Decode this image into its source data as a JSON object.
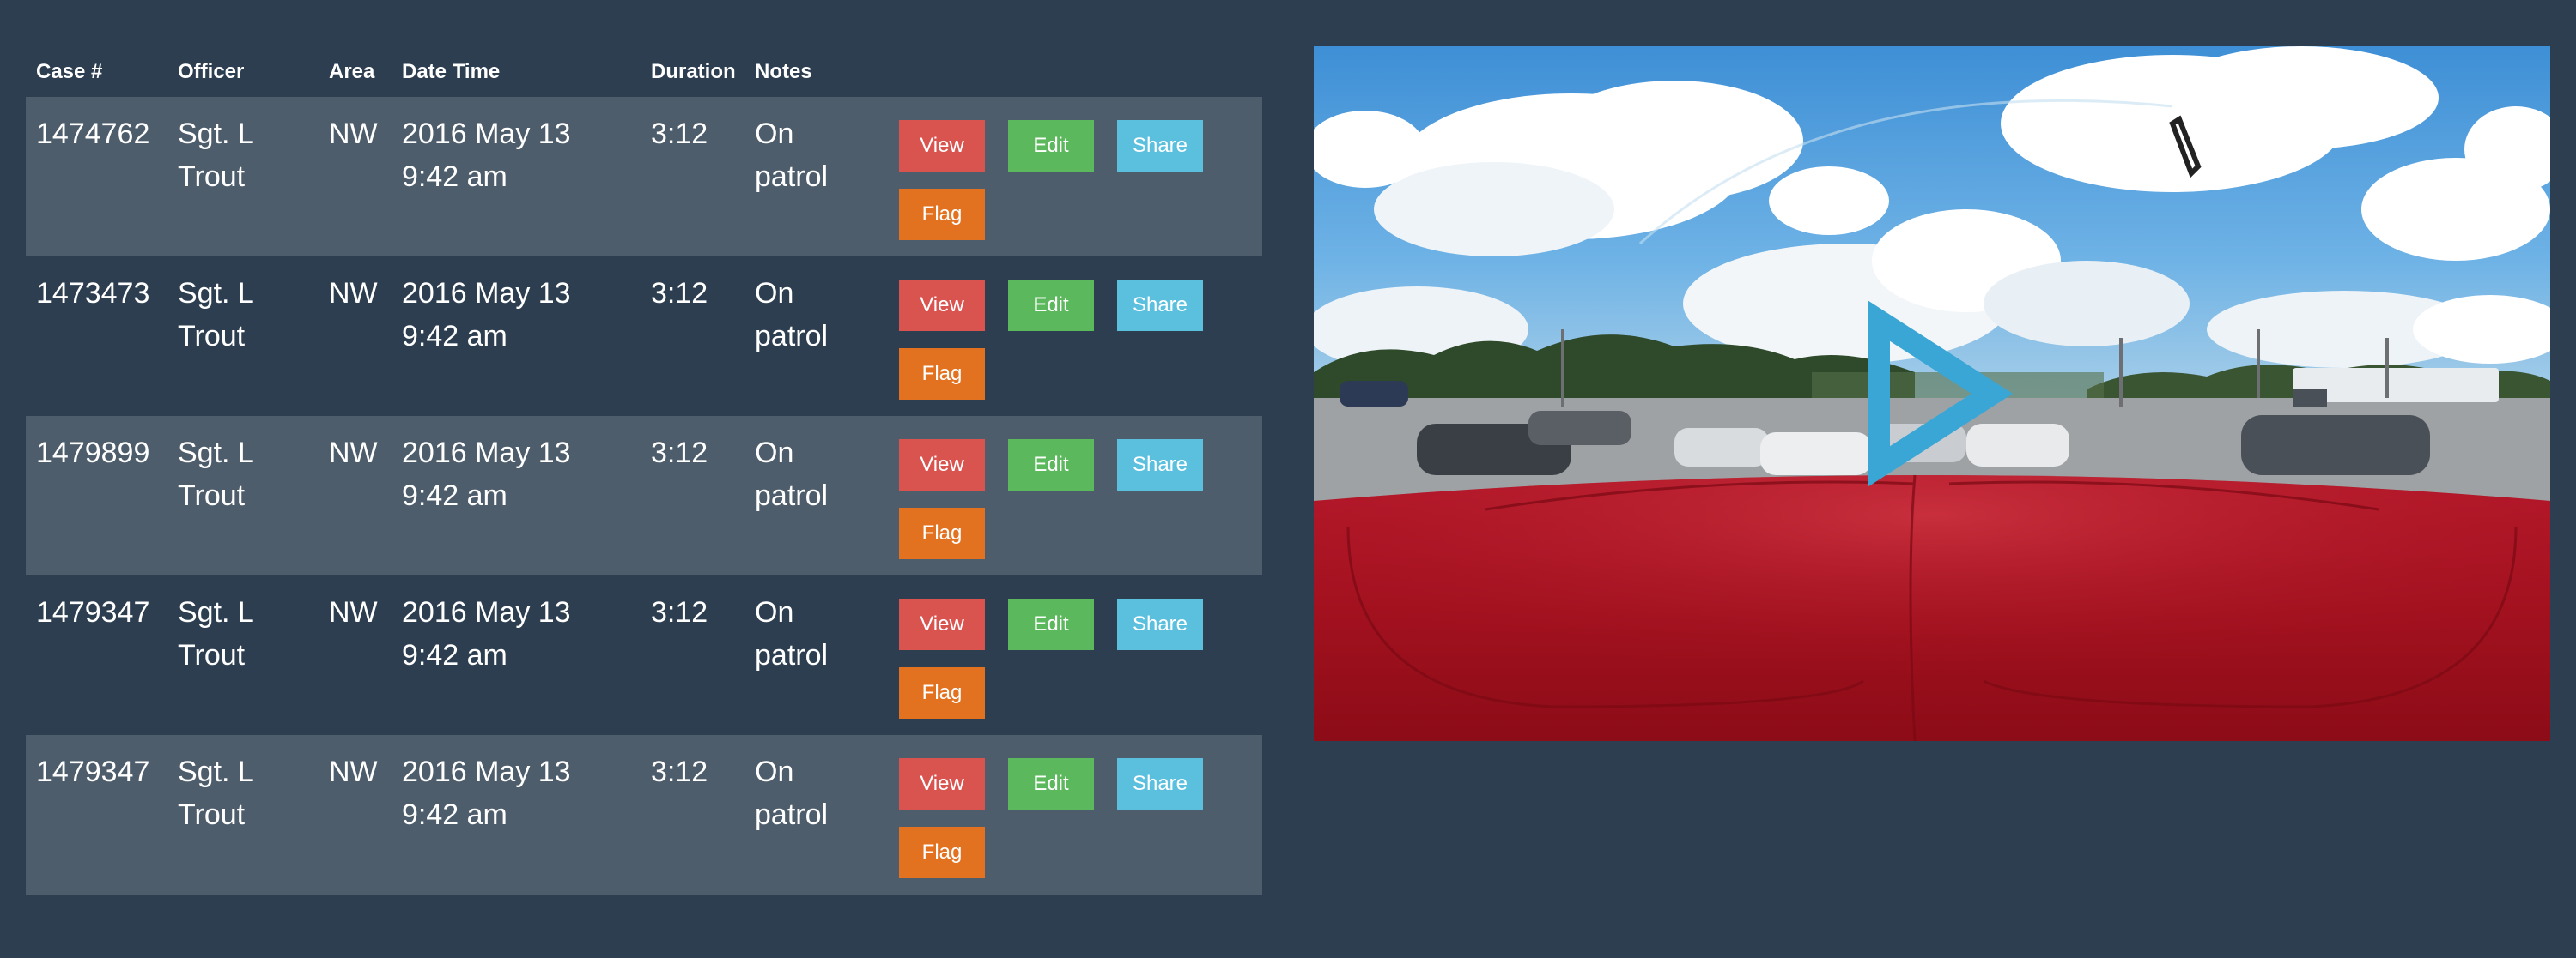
{
  "table": {
    "headers": {
      "case": "Case #",
      "officer": "Officer",
      "area": "Area",
      "datetime": "Date Time",
      "duration": "Duration",
      "notes": "Notes"
    },
    "rows": [
      {
        "case": "1474762",
        "officer_line1": "Sgt. L",
        "officer_line2": "Trout",
        "area": "NW",
        "date": "2016 May 13",
        "time": "9:42 am",
        "duration": "3:12",
        "notes_line1": "On",
        "notes_line2": "patrol"
      },
      {
        "case": "1473473",
        "officer_line1": "Sgt. L",
        "officer_line2": "Trout",
        "area": "NW",
        "date": "2016 May 13",
        "time": "9:42 am",
        "duration": "3:12",
        "notes_line1": "On",
        "notes_line2": "patrol"
      },
      {
        "case": "1479899",
        "officer_line1": "Sgt. L",
        "officer_line2": "Trout",
        "area": "NW",
        "date": "2016 May 13",
        "time": "9:42 am",
        "duration": "3:12",
        "notes_line1": "On",
        "notes_line2": "patrol"
      },
      {
        "case": "1479347",
        "officer_line1": "Sgt. L",
        "officer_line2": "Trout",
        "area": "NW",
        "date": "2016 May 13",
        "time": "9:42 am",
        "duration": "3:12",
        "notes_line1": "On",
        "notes_line2": "patrol"
      },
      {
        "case": "1479347",
        "officer_line1": "Sgt. L",
        "officer_line2": "Trout",
        "area": "NW",
        "date": "2016 May 13",
        "time": "9:42 am",
        "duration": "3:12",
        "notes_line1": "On",
        "notes_line2": "patrol"
      }
    ],
    "actions": {
      "view": "View",
      "edit": "Edit",
      "share": "Share",
      "flag": "Flag"
    }
  },
  "video": {
    "play_icon": "play-icon"
  },
  "colors": {
    "background": "#2c3e50",
    "row_stripe": "#4e5d6c",
    "view": "#d9534f",
    "edit": "#5cb85c",
    "share": "#5bc0de",
    "flag": "#e2721f",
    "play": "#3aa6d6"
  }
}
